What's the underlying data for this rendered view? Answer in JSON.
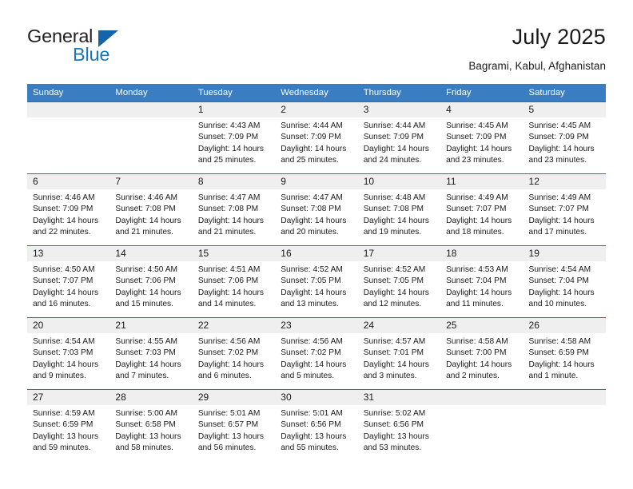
{
  "brand": {
    "name_top": "General",
    "name_bottom": "Blue",
    "triangle_color": "#1464aa",
    "blue_color": "#1b75bb"
  },
  "header": {
    "month_title": "July 2025",
    "location": "Bagrami, Kabul, Afghanistan"
  },
  "theme": {
    "header_bg": "#3a7dc0",
    "cell_top_border": "#2a6db5",
    "daynum_bg": "#efefef"
  },
  "weekdays": [
    "Sunday",
    "Monday",
    "Tuesday",
    "Wednesday",
    "Thursday",
    "Friday",
    "Saturday"
  ],
  "weeks": [
    [
      {
        "day": "",
        "sunrise": "",
        "sunset": "",
        "daylight1": "",
        "daylight2": ""
      },
      {
        "day": "",
        "sunrise": "",
        "sunset": "",
        "daylight1": "",
        "daylight2": ""
      },
      {
        "day": "1",
        "sunrise": "Sunrise: 4:43 AM",
        "sunset": "Sunset: 7:09 PM",
        "daylight1": "Daylight: 14 hours",
        "daylight2": "and 25 minutes."
      },
      {
        "day": "2",
        "sunrise": "Sunrise: 4:44 AM",
        "sunset": "Sunset: 7:09 PM",
        "daylight1": "Daylight: 14 hours",
        "daylight2": "and 25 minutes."
      },
      {
        "day": "3",
        "sunrise": "Sunrise: 4:44 AM",
        "sunset": "Sunset: 7:09 PM",
        "daylight1": "Daylight: 14 hours",
        "daylight2": "and 24 minutes."
      },
      {
        "day": "4",
        "sunrise": "Sunrise: 4:45 AM",
        "sunset": "Sunset: 7:09 PM",
        "daylight1": "Daylight: 14 hours",
        "daylight2": "and 23 minutes."
      },
      {
        "day": "5",
        "sunrise": "Sunrise: 4:45 AM",
        "sunset": "Sunset: 7:09 PM",
        "daylight1": "Daylight: 14 hours",
        "daylight2": "and 23 minutes."
      }
    ],
    [
      {
        "day": "6",
        "sunrise": "Sunrise: 4:46 AM",
        "sunset": "Sunset: 7:09 PM",
        "daylight1": "Daylight: 14 hours",
        "daylight2": "and 22 minutes."
      },
      {
        "day": "7",
        "sunrise": "Sunrise: 4:46 AM",
        "sunset": "Sunset: 7:08 PM",
        "daylight1": "Daylight: 14 hours",
        "daylight2": "and 21 minutes."
      },
      {
        "day": "8",
        "sunrise": "Sunrise: 4:47 AM",
        "sunset": "Sunset: 7:08 PM",
        "daylight1": "Daylight: 14 hours",
        "daylight2": "and 21 minutes."
      },
      {
        "day": "9",
        "sunrise": "Sunrise: 4:47 AM",
        "sunset": "Sunset: 7:08 PM",
        "daylight1": "Daylight: 14 hours",
        "daylight2": "and 20 minutes."
      },
      {
        "day": "10",
        "sunrise": "Sunrise: 4:48 AM",
        "sunset": "Sunset: 7:08 PM",
        "daylight1": "Daylight: 14 hours",
        "daylight2": "and 19 minutes."
      },
      {
        "day": "11",
        "sunrise": "Sunrise: 4:49 AM",
        "sunset": "Sunset: 7:07 PM",
        "daylight1": "Daylight: 14 hours",
        "daylight2": "and 18 minutes."
      },
      {
        "day": "12",
        "sunrise": "Sunrise: 4:49 AM",
        "sunset": "Sunset: 7:07 PM",
        "daylight1": "Daylight: 14 hours",
        "daylight2": "and 17 minutes."
      }
    ],
    [
      {
        "day": "13",
        "sunrise": "Sunrise: 4:50 AM",
        "sunset": "Sunset: 7:07 PM",
        "daylight1": "Daylight: 14 hours",
        "daylight2": "and 16 minutes."
      },
      {
        "day": "14",
        "sunrise": "Sunrise: 4:50 AM",
        "sunset": "Sunset: 7:06 PM",
        "daylight1": "Daylight: 14 hours",
        "daylight2": "and 15 minutes."
      },
      {
        "day": "15",
        "sunrise": "Sunrise: 4:51 AM",
        "sunset": "Sunset: 7:06 PM",
        "daylight1": "Daylight: 14 hours",
        "daylight2": "and 14 minutes."
      },
      {
        "day": "16",
        "sunrise": "Sunrise: 4:52 AM",
        "sunset": "Sunset: 7:05 PM",
        "daylight1": "Daylight: 14 hours",
        "daylight2": "and 13 minutes."
      },
      {
        "day": "17",
        "sunrise": "Sunrise: 4:52 AM",
        "sunset": "Sunset: 7:05 PM",
        "daylight1": "Daylight: 14 hours",
        "daylight2": "and 12 minutes."
      },
      {
        "day": "18",
        "sunrise": "Sunrise: 4:53 AM",
        "sunset": "Sunset: 7:04 PM",
        "daylight1": "Daylight: 14 hours",
        "daylight2": "and 11 minutes."
      },
      {
        "day": "19",
        "sunrise": "Sunrise: 4:54 AM",
        "sunset": "Sunset: 7:04 PM",
        "daylight1": "Daylight: 14 hours",
        "daylight2": "and 10 minutes."
      }
    ],
    [
      {
        "day": "20",
        "sunrise": "Sunrise: 4:54 AM",
        "sunset": "Sunset: 7:03 PM",
        "daylight1": "Daylight: 14 hours",
        "daylight2": "and 9 minutes."
      },
      {
        "day": "21",
        "sunrise": "Sunrise: 4:55 AM",
        "sunset": "Sunset: 7:03 PM",
        "daylight1": "Daylight: 14 hours",
        "daylight2": "and 7 minutes."
      },
      {
        "day": "22",
        "sunrise": "Sunrise: 4:56 AM",
        "sunset": "Sunset: 7:02 PM",
        "daylight1": "Daylight: 14 hours",
        "daylight2": "and 6 minutes."
      },
      {
        "day": "23",
        "sunrise": "Sunrise: 4:56 AM",
        "sunset": "Sunset: 7:02 PM",
        "daylight1": "Daylight: 14 hours",
        "daylight2": "and 5 minutes."
      },
      {
        "day": "24",
        "sunrise": "Sunrise: 4:57 AM",
        "sunset": "Sunset: 7:01 PM",
        "daylight1": "Daylight: 14 hours",
        "daylight2": "and 3 minutes."
      },
      {
        "day": "25",
        "sunrise": "Sunrise: 4:58 AM",
        "sunset": "Sunset: 7:00 PM",
        "daylight1": "Daylight: 14 hours",
        "daylight2": "and 2 minutes."
      },
      {
        "day": "26",
        "sunrise": "Sunrise: 4:58 AM",
        "sunset": "Sunset: 6:59 PM",
        "daylight1": "Daylight: 14 hours",
        "daylight2": "and 1 minute."
      }
    ],
    [
      {
        "day": "27",
        "sunrise": "Sunrise: 4:59 AM",
        "sunset": "Sunset: 6:59 PM",
        "daylight1": "Daylight: 13 hours",
        "daylight2": "and 59 minutes."
      },
      {
        "day": "28",
        "sunrise": "Sunrise: 5:00 AM",
        "sunset": "Sunset: 6:58 PM",
        "daylight1": "Daylight: 13 hours",
        "daylight2": "and 58 minutes."
      },
      {
        "day": "29",
        "sunrise": "Sunrise: 5:01 AM",
        "sunset": "Sunset: 6:57 PM",
        "daylight1": "Daylight: 13 hours",
        "daylight2": "and 56 minutes."
      },
      {
        "day": "30",
        "sunrise": "Sunrise: 5:01 AM",
        "sunset": "Sunset: 6:56 PM",
        "daylight1": "Daylight: 13 hours",
        "daylight2": "and 55 minutes."
      },
      {
        "day": "31",
        "sunrise": "Sunrise: 5:02 AM",
        "sunset": "Sunset: 6:56 PM",
        "daylight1": "Daylight: 13 hours",
        "daylight2": "and 53 minutes."
      },
      {
        "day": "",
        "sunrise": "",
        "sunset": "",
        "daylight1": "",
        "daylight2": ""
      },
      {
        "day": "",
        "sunrise": "",
        "sunset": "",
        "daylight1": "",
        "daylight2": ""
      }
    ]
  ]
}
